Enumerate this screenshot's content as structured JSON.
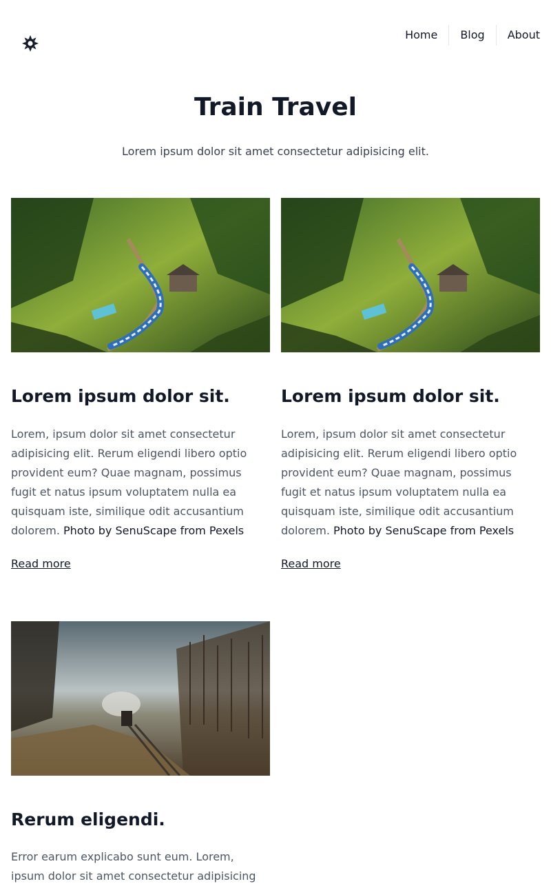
{
  "header": {
    "theme_toggle_icon": "sun-icon",
    "nav": [
      {
        "label": "Home"
      },
      {
        "label": "Blog"
      },
      {
        "label": "About"
      }
    ]
  },
  "hero": {
    "title": "Train Travel",
    "subtitle": "Lorem ipsum dolor sit amet consectetur adipisicing elit."
  },
  "posts": [
    {
      "image": "train-in-green-mountains-photo",
      "title": "Lorem ipsum dolor sit.",
      "excerpt": "Lorem, ipsum dolor sit amet consectetur adipisicing elit. Rerum eligendi libero optio provident eum? Quae magnam, possimus fugit et natus ipsum voluptatem nulla ea quisquam iste, similique odit accusantium dolorem. ",
      "credit": "Photo by SenuScape from Pexels",
      "read_more": "Read more"
    },
    {
      "image": "train-in-green-mountains-photo",
      "title": "Lorem ipsum dolor sit.",
      "excerpt": "Lorem, ipsum dolor sit amet consectetur adipisicing elit. Rerum eligendi libero optio provident eum? Quae magnam, possimus fugit et natus ipsum voluptatem nulla ea quisquam iste, similique odit accusantium dolorem. ",
      "credit": "Photo by SenuScape from Pexels",
      "read_more": "Read more"
    },
    {
      "image": "steam-train-in-forest-photo",
      "title": "Rerum eligendi.",
      "excerpt": "Error earum explicabo sunt eum. Lorem, ipsum dolor sit amet consectetur adipisicing",
      "credit": "",
      "read_more": ""
    }
  ],
  "colors": {
    "text": "#111827",
    "muted": "#4b5563",
    "border": "#e5e7eb"
  }
}
